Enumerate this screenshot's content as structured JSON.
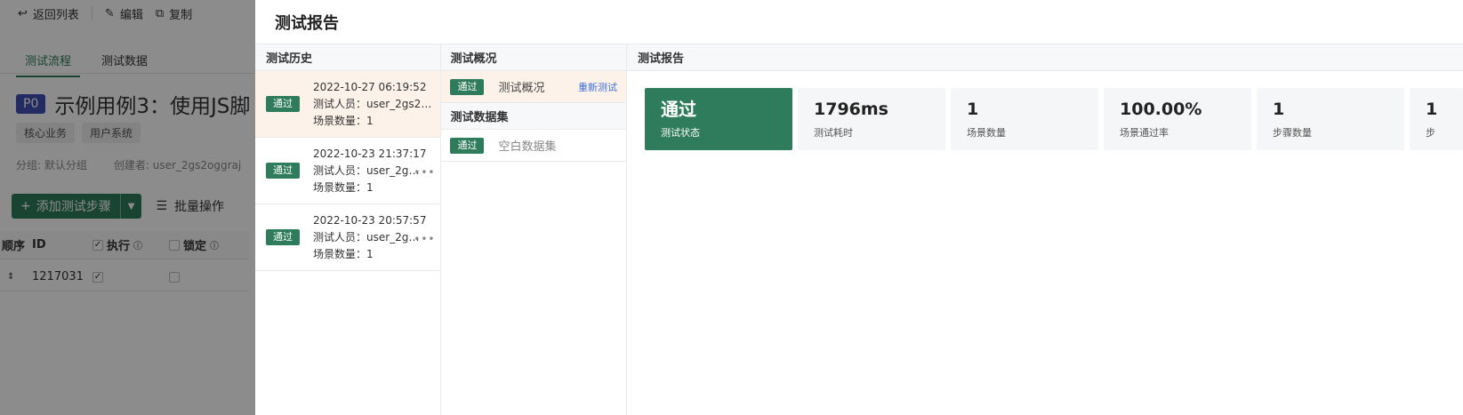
{
  "background": {
    "toolbar": {
      "back": "返回列表",
      "edit": "编辑",
      "copy": "复制"
    },
    "tabs": [
      "测试流程",
      "测试数据"
    ],
    "priority": "P0",
    "case_title": "示例用例3：使用JS脚",
    "tags": [
      "核心业务",
      "用户系统"
    ],
    "meta": {
      "group": "分组: 默认分组",
      "creator": "创建者: user_2gs2oggraj"
    },
    "add_step": "添加测试步骤",
    "batch": "批量操作",
    "table": {
      "headers": {
        "order": "顺序",
        "id": "ID",
        "execute": "执行",
        "lock": "锁定"
      },
      "row": {
        "id": "1217031"
      }
    }
  },
  "drawer": {
    "title": "测试报告",
    "history": {
      "title": "测试历史",
      "items": [
        {
          "status": "通过",
          "time": "2022-10-27 06:19:52",
          "tester": "测试人员：user_2gs2og...",
          "scenes": "场景数量：1"
        },
        {
          "status": "通过",
          "time": "2022-10-23 21:37:17",
          "tester": "测试人员：user_2gs...",
          "scenes": "场景数量：1"
        },
        {
          "status": "通过",
          "time": "2022-10-23 20:57:57",
          "tester": "测试人员：user_2gs...",
          "scenes": "场景数量：1"
        }
      ]
    },
    "overview": {
      "title": "测试概况",
      "item": {
        "status": "通过",
        "label": "测试概况",
        "retest": "重新测试"
      },
      "dataset_title": "测试数据集",
      "dataset_item": {
        "status": "通过",
        "label": "空白数据集"
      }
    },
    "report": {
      "title": "测试报告",
      "stats": [
        {
          "value": "通过",
          "label": "测试状态"
        },
        {
          "value": "1796ms",
          "label": "测试耗时"
        },
        {
          "value": "1",
          "label": "场景数量"
        },
        {
          "value": "100.00%",
          "label": "场景通过率"
        },
        {
          "value": "1",
          "label": "步骤数量"
        },
        {
          "value": "1",
          "label": "步"
        }
      ]
    }
  },
  "colors": {
    "primary_green": "#2f7c5c",
    "selected_bg": "#fdf2e9",
    "link_blue": "#3b6fd8"
  }
}
